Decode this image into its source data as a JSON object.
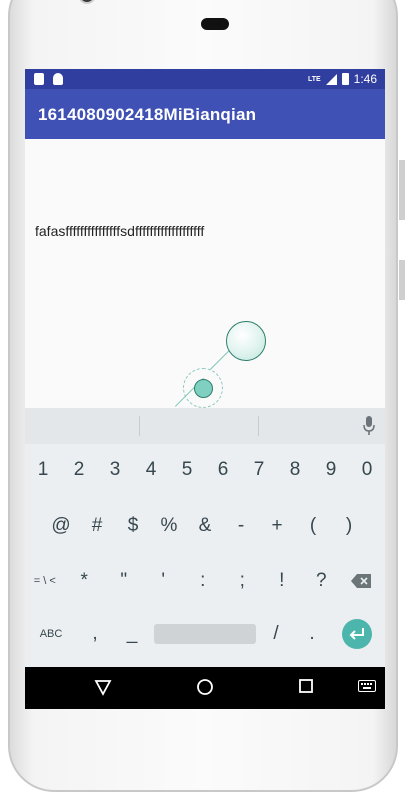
{
  "status_bar": {
    "network": "LTE",
    "time": "1:46"
  },
  "app_bar": {
    "title": "1614080902418MiBianqian"
  },
  "content": {
    "edit_text": "fafasfffffffffffffffsdfffffffffffffffffff"
  },
  "keyboard": {
    "number_row": [
      "1",
      "2",
      "3",
      "4",
      "5",
      "6",
      "7",
      "8",
      "9",
      "0"
    ],
    "symbol_row_1": [
      "@",
      "#",
      "$",
      "%",
      "&",
      "-",
      "+",
      "(",
      ")"
    ],
    "symbol_row_2": [
      "= \\ <",
      "*",
      "\"",
      "'",
      ":",
      ";",
      "!",
      "?"
    ],
    "bottom_row": {
      "abc": "ABC",
      "comma": ",",
      "underscore": "_",
      "slash": "/",
      "period": "."
    }
  },
  "colors": {
    "primary": "#3F51B5",
    "primary_dark": "#303F9F",
    "accent": "#4DB6AC"
  }
}
